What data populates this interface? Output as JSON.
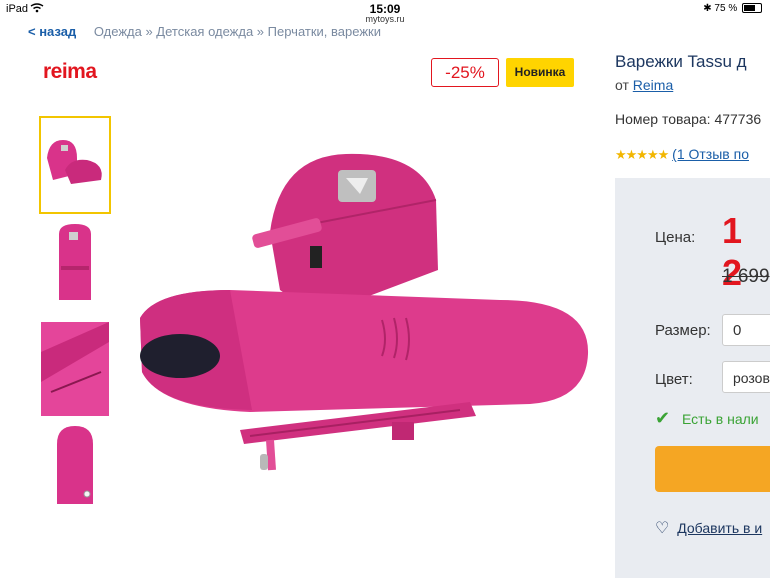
{
  "status_bar": {
    "device": "iPad",
    "time": "15:09",
    "url": "mytoys.ru",
    "battery": "75 %"
  },
  "breadcrumb": {
    "back": "< назад",
    "path": "Одежда » Детская одежда » Перчатки, варежки"
  },
  "brand_logo": "reima",
  "badges": {
    "discount": "-25%",
    "new": "Новинка"
  },
  "product": {
    "title": "Варежки Tassu д",
    "from_label": "от",
    "brand": "Reima",
    "sku": "Номер товара: 477736",
    "rating_stars": 5,
    "reviews": "(1 Отзыв по",
    "price_label": "Цена:",
    "price": "1 2",
    "old_price": "1 699",
    "size_label": "Размер:",
    "size_value": "0",
    "color_label": "Цвет:",
    "color_value": "розов",
    "stock": "Есть в нали",
    "wishlist": "Добавить в и"
  },
  "thumbnails": [
    "mittens-pair",
    "mitten-front",
    "mitten-detail",
    "mitten-single"
  ],
  "colors": {
    "accent": "#e2161f",
    "badge": "#ffd400",
    "product": "#d9338a",
    "link": "#1a5ea8",
    "cta": "#f5a623",
    "ok": "#3aa335"
  }
}
